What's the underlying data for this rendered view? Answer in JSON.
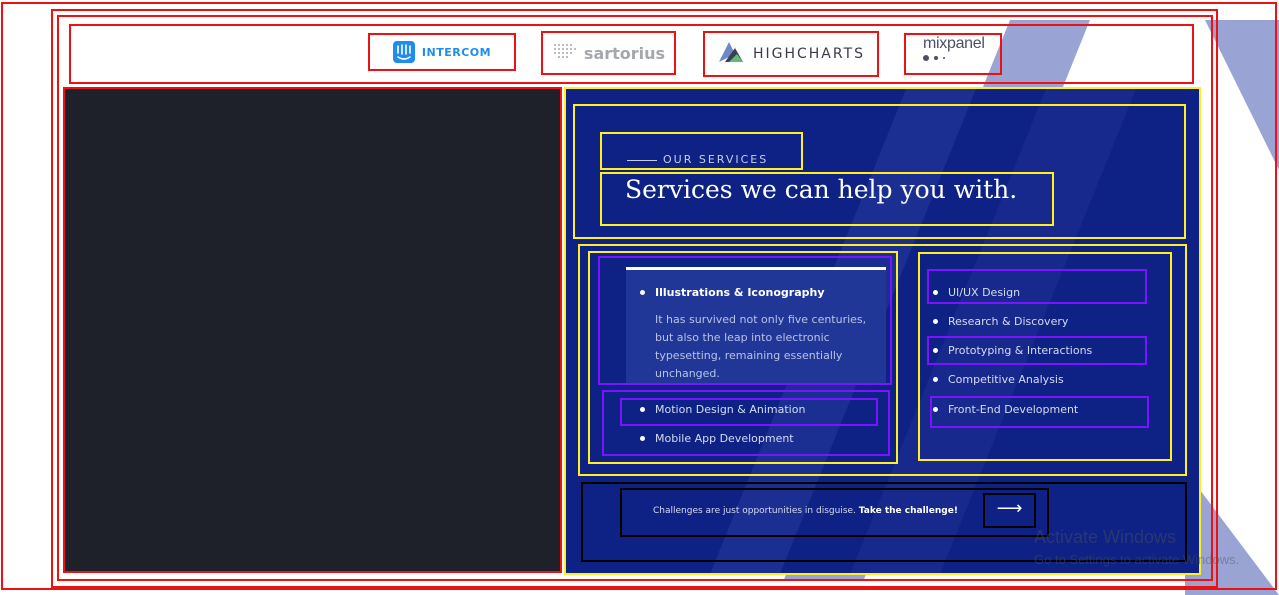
{
  "partners": {
    "intercom": "INTERCOM",
    "sartorius": "sartorius",
    "highcharts": "HIGHCHARTS",
    "mixpanel": "mixpanel"
  },
  "services_section": {
    "eyebrow": "OUR SERVICES",
    "title": "Services we can help you with.",
    "featured": {
      "label": "Illustrations & Iconography",
      "description": "It has survived not only five centuries, but also the leap into electronic typesetting, remaining essentially unchanged."
    },
    "left_list": [
      "Motion Design & Animation",
      "Mobile App Development"
    ],
    "right_list": [
      "UI/UX Design",
      "Research & Discovery",
      "Prototyping & Interactions",
      "Competitive Analysis",
      "Front-End Development"
    ]
  },
  "cta": {
    "text": "Challenges are just opportunities in disguise.",
    "link": "Take the challenge!",
    "arrow": "⟶"
  },
  "watermark": {
    "line1": "Activate Windows",
    "line2": "Go to Settings to activate Windows."
  },
  "colors": {
    "panel_blue": "#0e2285",
    "panel_dark": "#1e212a",
    "outline_red": "#ee1111",
    "outline_yellow": "#ffee22",
    "outline_purple": "#7a14ff"
  }
}
